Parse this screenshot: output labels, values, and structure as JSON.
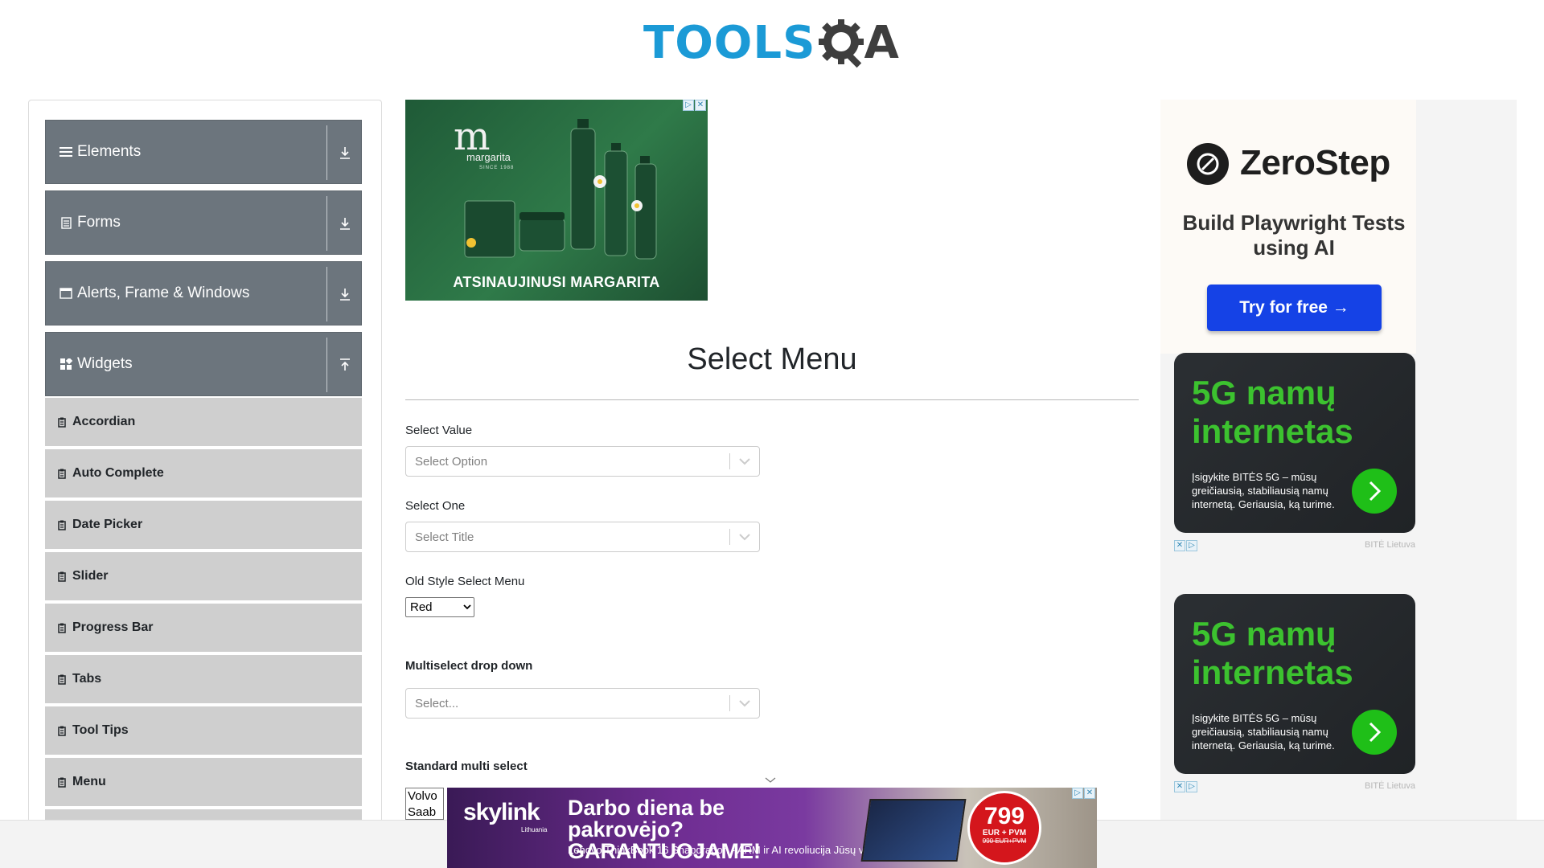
{
  "logo": {
    "part1": "TOOLS",
    "part2": "A"
  },
  "sidebar": {
    "groups": [
      {
        "label": "Elements",
        "icon": "menu-icon",
        "expanded": false
      },
      {
        "label": "Forms",
        "icon": "document-icon",
        "expanded": false
      },
      {
        "label": "Alerts, Frame & Windows",
        "icon": "window-icon",
        "expanded": false
      },
      {
        "label": "Widgets",
        "icon": "widgets-icon",
        "expanded": true
      }
    ],
    "items": [
      {
        "label": "Accordian"
      },
      {
        "label": "Auto Complete"
      },
      {
        "label": "Date Picker"
      },
      {
        "label": "Slider"
      },
      {
        "label": "Progress Bar"
      },
      {
        "label": "Tabs"
      },
      {
        "label": "Tool Tips"
      },
      {
        "label": "Menu"
      }
    ]
  },
  "ads": {
    "margarita": {
      "brand": "margarita",
      "since": "SINCE 1988",
      "caption": "ATSINAUJINUSI MARGARITA"
    },
    "zerostep": {
      "name": "ZeroStep",
      "tagline": "Build Playwright Tests using AI",
      "button": "Try for free →"
    },
    "bite": [
      {
        "headline": "5G namų internetas",
        "body": "Įsigykite BITĖS 5G – mūsų greičiausią, stabiliausią namų internetą. Geriausia, ką turime.",
        "sponsor": "BITĖ Lietuva"
      },
      {
        "headline": "5G namų internetas",
        "body": "Įsigykite BITĖS 5G – mūsų greičiausią, stabiliausią namų internetą. Geriausia, ką turime.",
        "sponsor": "BITĖ Lietuva"
      }
    ],
    "skylink": {
      "brand": "skylink",
      "brand_sub": "Lithuania",
      "headline": "Darbo diena be pakrovėjo? GARANTUOJAME!",
      "sub": "Lenovo ThinkBook 16 Snapdragon - ARM ir AI revoliucija Jūsų versle!",
      "price": "799",
      "price_unit": "EUR + PVM",
      "old_price": "990 EUR+PVM"
    }
  },
  "main": {
    "title": "Select Menu",
    "select_value": {
      "label": "Select Value",
      "placeholder": "Select Option"
    },
    "select_one": {
      "label": "Select One",
      "placeholder": "Select Title"
    },
    "old_style": {
      "label": "Old Style Select Menu",
      "value": "Red"
    },
    "multiselect": {
      "label": "Multiselect drop down",
      "placeholder": "Select..."
    },
    "standard_multi": {
      "label": "Standard multi select",
      "options": [
        "Volvo",
        "Saab"
      ]
    }
  },
  "colors": {
    "logo_blue": "#1b9ad6",
    "logo_dark": "#3e3e3e",
    "group_bg": "#6c757d",
    "item_bg": "#cfcfcf",
    "zerostep_button": "#1542e6",
    "bite_green": "#3cc22f"
  }
}
